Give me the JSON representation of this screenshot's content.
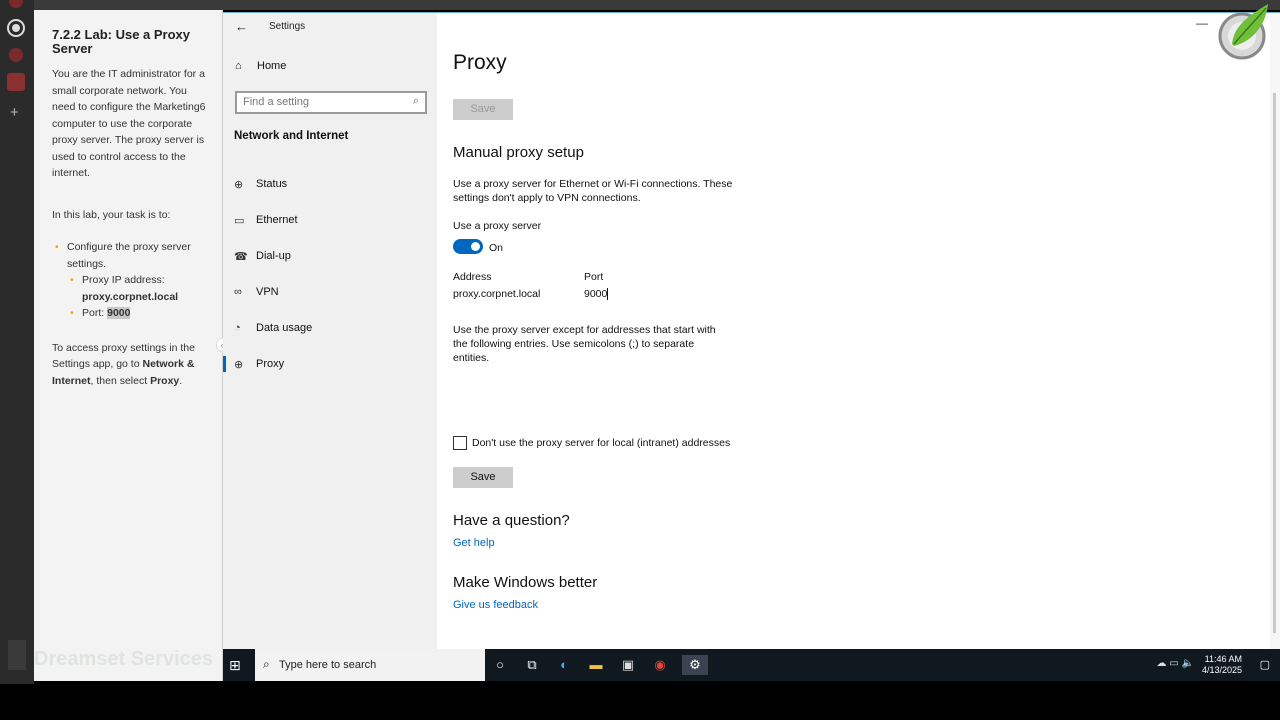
{
  "instructions": {
    "title": "7.2.2 Lab: Use a Proxy Server",
    "intro": "You are the IT administrator for a small corporate network. You need to configure the Marketing6 computer to use the corporate proxy server. The proxy server is used to control access to the internet.",
    "task_lead": "In this lab, your task is to:",
    "task_main": "Configure the proxy server settings.",
    "proxy_ip_label": "Proxy IP address:",
    "proxy_ip_value": "proxy.corpnet.local",
    "port_label": "Port:",
    "port_value": "9000",
    "access_text_1": "To access proxy settings in the Settings app, go to",
    "access_bold_1": "Network & Internet",
    "access_text_2": ", then select",
    "access_bold_2": "Proxy",
    "access_text_3": ".",
    "watermark": "Dreamset Services"
  },
  "window": {
    "title": "Settings",
    "minimize": "—"
  },
  "nav": {
    "home_label": "Home",
    "search_placeholder": "Find a setting",
    "section_title": "Network and Internet",
    "items": [
      {
        "label": "Status",
        "icon": "globe-status-icon"
      },
      {
        "label": "Ethernet",
        "icon": "ethernet-icon"
      },
      {
        "label": "Dial-up",
        "icon": "dialup-icon"
      },
      {
        "label": "VPN",
        "icon": "vpn-icon"
      },
      {
        "label": "Data usage",
        "icon": "data-usage-icon"
      },
      {
        "label": "Proxy",
        "icon": "globe-icon"
      }
    ]
  },
  "content": {
    "page_title": "Proxy",
    "save_top_label": "Save",
    "manual_title": "Manual proxy setup",
    "manual_desc": "Use a proxy server for Ethernet or Wi-Fi connections. These settings don't apply to VPN connections.",
    "use_proxy_label": "Use a proxy server",
    "toggle_state": "On",
    "address_label": "Address",
    "address_value": "proxy.corpnet.local",
    "port_label": "Port",
    "port_value": "9000",
    "exceptions_desc": "Use the proxy server except for addresses that start with the following entries. Use semicolons (;) to separate entities.",
    "local_checkbox_label": "Don't use the proxy server for local (intranet) addresses",
    "save_bottom_label": "Save",
    "question_title": "Have a question?",
    "get_help_link": "Get help",
    "better_title": "Make Windows better",
    "feedback_link": "Give us feedback"
  },
  "taskbar": {
    "search_placeholder": "Type here to search",
    "time": "11:46 AM",
    "date": "4/13/2025"
  },
  "colors": {
    "accent": "#0067c0",
    "bullet": "#e6a817",
    "taskbar": "#101820"
  }
}
